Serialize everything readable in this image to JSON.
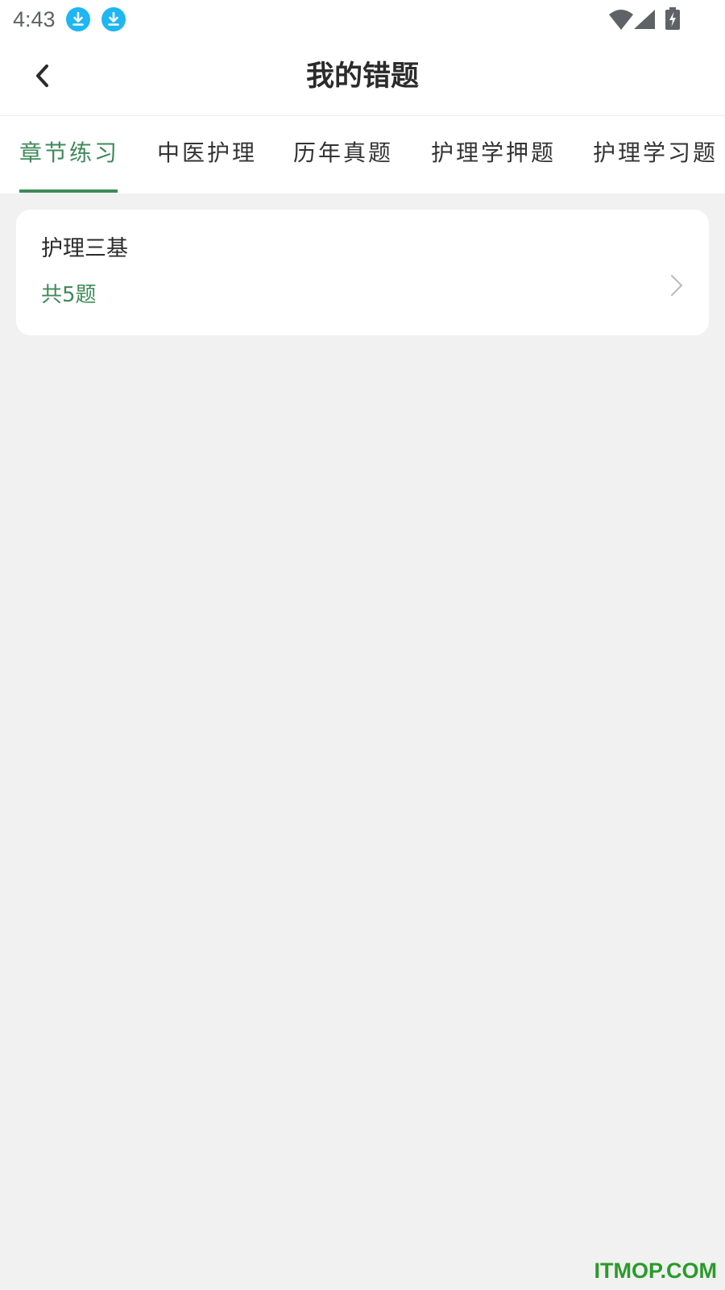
{
  "status_bar": {
    "time": "4:43",
    "notification_icons": [
      "download-icon",
      "download-icon"
    ],
    "system_icons": [
      "wifi-icon",
      "signal-icon",
      "battery-charging-icon"
    ],
    "notification_color": "#1eb6f3"
  },
  "header": {
    "title": "我的错题",
    "back_icon": "chevron-left-icon"
  },
  "tabs": [
    {
      "label": "章节练习",
      "active": true
    },
    {
      "label": "中医护理",
      "active": false
    },
    {
      "label": "历年真题",
      "active": false
    },
    {
      "label": "护理学押题",
      "active": false
    },
    {
      "label": "护理学习题",
      "active": false
    }
  ],
  "items": [
    {
      "title": "护理三基",
      "count": "共5题",
      "arrow_icon": "chevron-right-icon"
    }
  ],
  "watermark": "ITMOP.COM",
  "colors": {
    "accent": "#3f8a5a",
    "background": "#f1f1f1",
    "card": "#ffffff",
    "watermark": "#2a9a2a"
  }
}
